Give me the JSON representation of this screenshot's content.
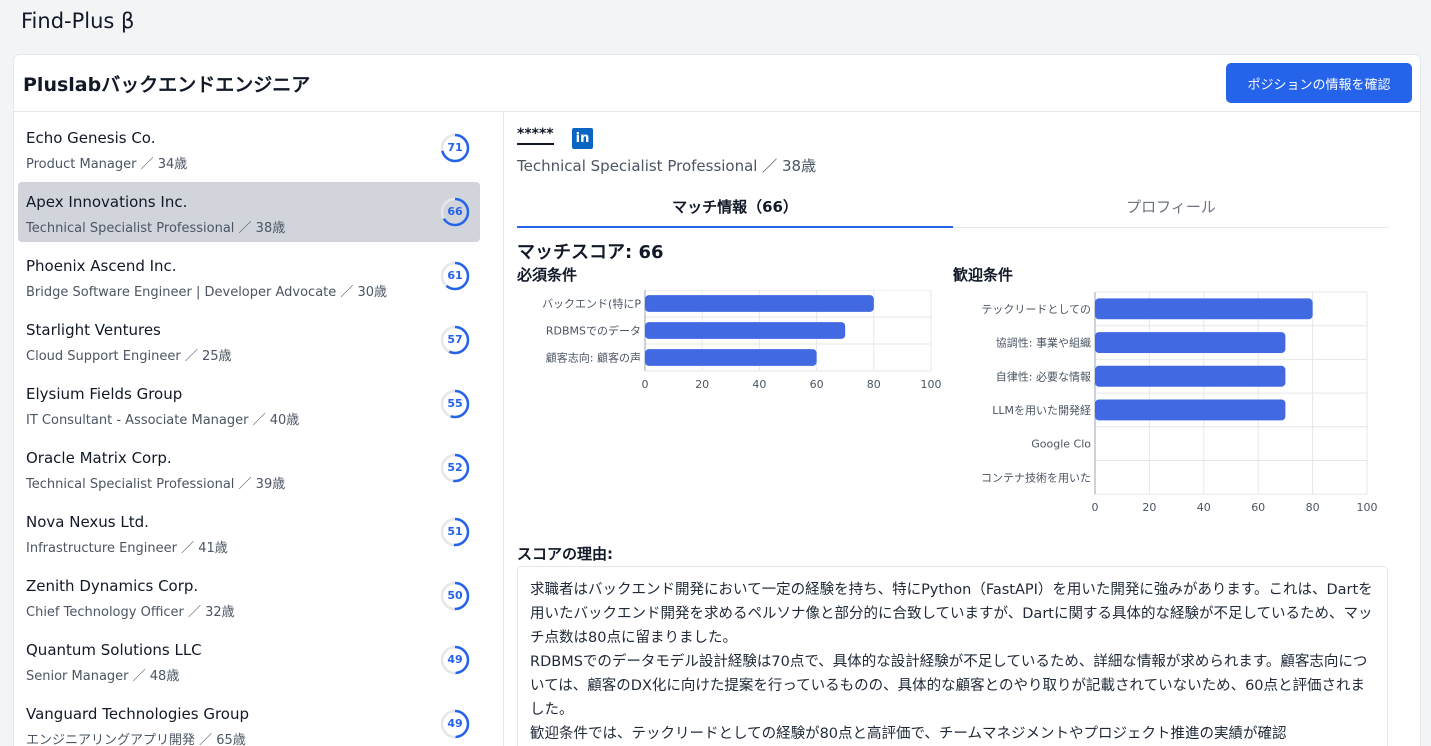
{
  "app": {
    "title": "Find-Plus β"
  },
  "header": {
    "title": "Pluslabバックエンドエンジニア",
    "confirm_button": "ポジションの情報を確認"
  },
  "candidates": [
    {
      "name": "Echo Genesis Co.",
      "sub": "Product Manager ／ 34歳",
      "score": "71",
      "score_value": 71,
      "active": false
    },
    {
      "name": "Apex Innovations Inc.",
      "sub": "Technical Specialist Professional ／ 38歳",
      "score": "66",
      "score_value": 66,
      "active": true
    },
    {
      "name": "Phoenix Ascend Inc.",
      "sub": "Bridge Software Engineer | Developer Advocate ／ 30歳",
      "score": "61",
      "score_value": 61,
      "active": false
    },
    {
      "name": "Starlight Ventures",
      "sub": "Cloud Support Engineer ／ 25歳",
      "score": "57",
      "score_value": 57,
      "active": false
    },
    {
      "name": "Elysium Fields Group",
      "sub": "IT Consultant - Associate Manager ／ 40歳",
      "score": "55",
      "score_value": 55,
      "active": false
    },
    {
      "name": "Oracle Matrix Corp.",
      "sub": "Technical Specialist Professional ／ 39歳",
      "score": "52",
      "score_value": 52,
      "active": false
    },
    {
      "name": "Nova Nexus Ltd.",
      "sub": "Infrastructure Engineer ／ 41歳",
      "score": "51",
      "score_value": 51,
      "active": false
    },
    {
      "name": "Zenith Dynamics Corp.",
      "sub": "Chief Technology Officer ／ 32歳",
      "score": "50",
      "score_value": 50,
      "active": false
    },
    {
      "name": "Quantum Solutions LLC",
      "sub": "Senior Manager ／ 48歳",
      "score": "49",
      "score_value": 49,
      "active": false
    },
    {
      "name": "Vanguard Technologies Group",
      "sub": "エンジニアリングアプリ開発 ／ 65歳",
      "score": "49",
      "score_value": 49,
      "active": false
    }
  ],
  "detail": {
    "masked_name": "*****",
    "linkedin_glyph": "in",
    "subtitle": "Technical Specialist Professional ／ 38歳",
    "tabs": [
      "マッチ情報（66）",
      "プロフィール"
    ],
    "match_score_label": "マッチスコア: 66",
    "required_label": "必須条件",
    "preferred_label": "歓迎条件",
    "reason_title": "スコアの理由:",
    "reason_paragraphs": [
      "求職者はバックエンド開発において一定の経験を持ち、特にPython（FastAPI）を用いた開発に強みがあります。これは、Dartを用いたバックエンド開発を求めるペルソナ像と部分的に合致していますが、Dartに関する具体的な経験が不足しているため、マッチ点数は80点に留まりました。",
      "RDBMSでのデータモデル設計経験は70点で、具体的な設計経験が不足しているため、詳細な情報が求められます。顧客志向については、顧客のDX化に向けた提案を行っているものの、具体的な顧客とのやり取りが記載されていないため、60点と評価されました。",
      "歓迎条件では、テックリードとしての経験が80点と高評価で、チームマネジメントやプロジェクト推進の実績が確認"
    ]
  },
  "chart_data": [
    {
      "type": "bar",
      "orientation": "horizontal",
      "categories": [
        "バックエンド(特にP",
        "RDBMSでのデータ",
        "顧客志向: 顧客の声"
      ],
      "values": [
        80,
        70,
        60
      ],
      "xlim": [
        0,
        100
      ],
      "xticks": [
        "0",
        "20",
        "40",
        "60",
        "80",
        "100"
      ],
      "grid": true,
      "color": "#4169e1"
    },
    {
      "type": "bar",
      "orientation": "horizontal",
      "categories": [
        "テックリードとしての",
        "協調性: 事業や組織",
        "自律性: 必要な情報",
        "LLMを用いた開発経",
        "Google Clo",
        "コンテナ技術を用いた"
      ],
      "values": [
        80,
        70,
        70,
        70,
        0,
        0
      ],
      "xlim": [
        0,
        100
      ],
      "xticks": [
        "0",
        "20",
        "40",
        "60",
        "80",
        "100"
      ],
      "grid": true,
      "color": "#4169e1"
    }
  ],
  "colors": {
    "accent": "#2563eb",
    "bar": "#4169e1",
    "selected_row": "#d1d5db"
  }
}
